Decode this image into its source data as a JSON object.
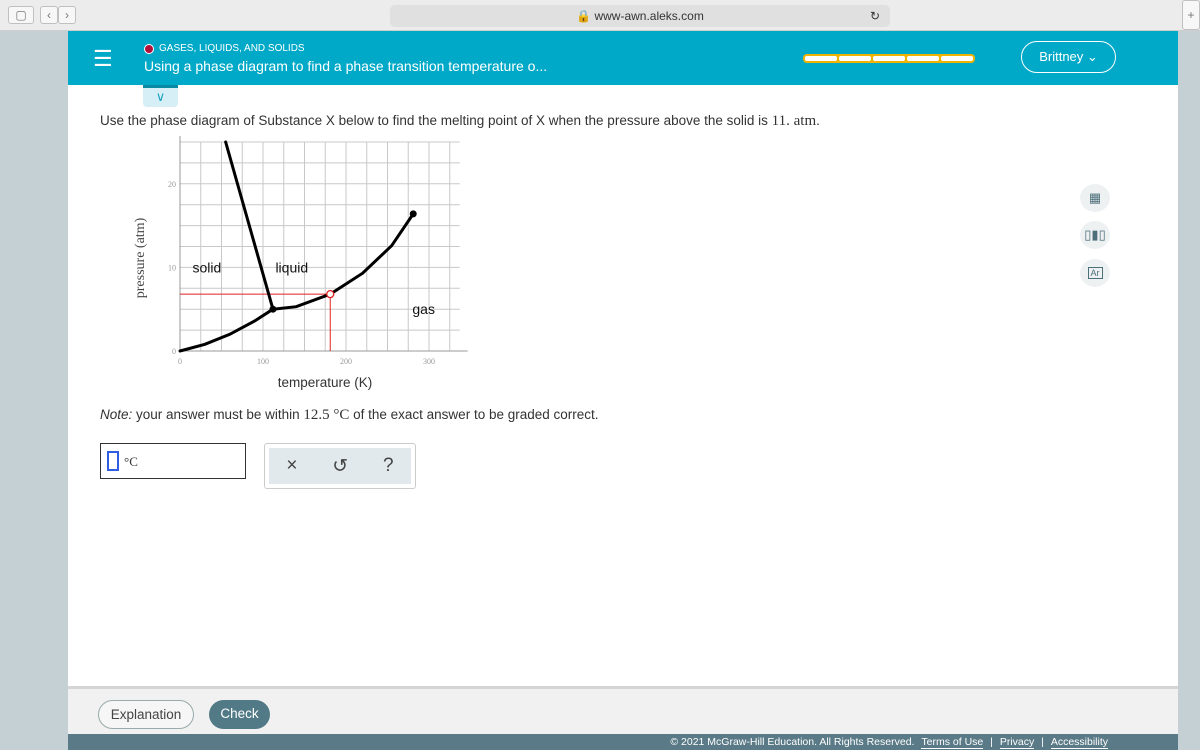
{
  "browser": {
    "url": "www-awn.aleks.com"
  },
  "header": {
    "topic": "GASES, LIQUIDS, AND SOLIDS",
    "title": "Using a phase diagram to find a phase transition temperature o...",
    "user": "Brittney",
    "progress_segments": 5,
    "progress_complete": 0
  },
  "question": {
    "pre": "Use the phase diagram of Substance X below to find the melting point of X when the pressure above the solid is ",
    "value": "11.",
    "unit": "atm",
    "post": "."
  },
  "chart_data": {
    "type": "line",
    "xlabel": "temperature (K)",
    "ylabel": "pressure (atm)",
    "xlim": [
      0,
      337
    ],
    "ylim": [
      0,
      25
    ],
    "xticks": [
      0,
      100,
      200,
      300
    ],
    "yticks": [
      0,
      10,
      20
    ],
    "grid": true,
    "regions": [
      "solid",
      "liquid",
      "gas"
    ],
    "series": [
      {
        "points": [
          [
            55,
            25
          ],
          [
            112,
            5
          ]
        ]
      },
      {
        "points": [
          [
            0,
            0
          ],
          [
            30,
            0.8
          ],
          [
            60,
            2
          ],
          [
            90,
            3.6
          ],
          [
            112,
            5
          ]
        ]
      },
      {
        "points": [
          [
            112,
            5
          ],
          [
            140,
            5.3
          ],
          [
            181,
            6.8
          ],
          [
            220,
            9.3
          ],
          [
            255,
            12.6
          ],
          [
            281,
            16.4
          ]
        ]
      }
    ],
    "triple_point": [
      112,
      5
    ],
    "critical_point": [
      281,
      16.4
    ],
    "marker": [
      181,
      6.8
    ],
    "marker_color": "#e02020"
  },
  "note": {
    "label": "Note:",
    "pre": " your answer must be within ",
    "value": "12.5 °C",
    "post": " of the exact answer to be graded correct."
  },
  "answer": {
    "value": "",
    "unit": "°C"
  },
  "tools": {
    "clear": "×",
    "undo": "↺",
    "help": "?"
  },
  "sidebar_icons": [
    "calculator-icon",
    "chart-icon",
    "periodic-table-icon"
  ],
  "periodic_label": "Ar",
  "buttons": {
    "explanation": "Explanation",
    "check": "Check"
  },
  "footer": {
    "copyright": "© 2021 McGraw-Hill Education. All Rights Reserved.",
    "terms": "Terms of Use",
    "privacy": "Privacy",
    "accessibility": "Accessibility"
  },
  "colors": {
    "header": "#00a9c7",
    "footer": "#597a86",
    "check": "#527a86"
  }
}
